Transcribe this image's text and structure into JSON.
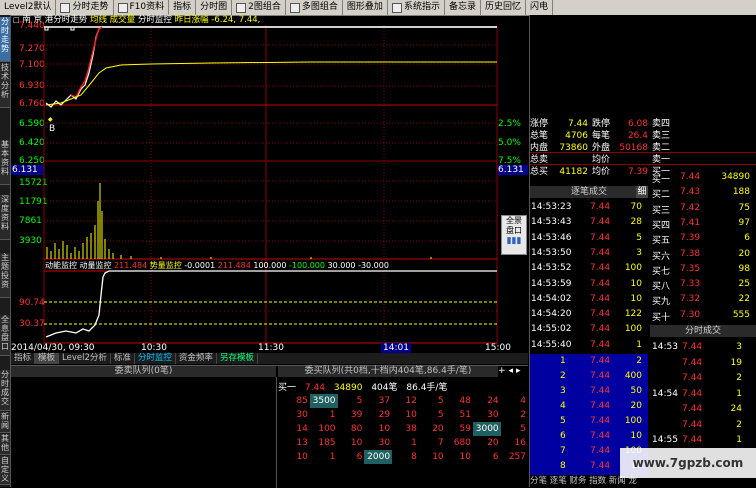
{
  "toolbar": {
    "items": [
      "Level2默认",
      "分时走势",
      "F10资料",
      "指标",
      "分时图",
      "2图组合",
      "多图组合",
      "图形叠加",
      "系统指示",
      "备忘录",
      "历史回忆",
      "闪电"
    ]
  },
  "left_tabs": [
    "分时走势",
    "技术分析",
    "基本资料",
    "深度资料",
    "主题投资",
    "全息盘口",
    "分时成交",
    "新闻",
    "其他",
    "自定义"
  ],
  "chart": {
    "header": {
      "stock": "南  京  港分时走势",
      "avg_line": "均线",
      "volume": "成交量",
      "monitor": "分时监控",
      "prev_rise": "昨日涨幅",
      "prev_rise_val": "-6.24, 7.44,"
    },
    "price_ticks": [
      "7.440",
      "7.270",
      "7.100",
      "6.930",
      "6.760",
      "6.590",
      "6.420",
      "6.250"
    ],
    "pct_ticks": [
      "2.5%",
      "5.0%",
      "7.5%"
    ],
    "current_price": "6.131",
    "current_price_right": "6.131",
    "marker_b": "B",
    "vol_ticks": [
      "15721",
      "11791",
      "7861",
      "3930"
    ],
    "monitor_header": {
      "label1": "动能监控",
      "label2": "动量监控",
      "v1": "211.484",
      "label3": "势量监控",
      "v2": "-0.0001",
      "v3": "211.484",
      "v4": "100.000",
      "v5": "-100.000",
      "v6": "30.000",
      "v7": "-30.000"
    },
    "monitor_ticks": [
      "90.74",
      "30.37"
    ],
    "time_axis": {
      "start": "2014/04/30, 09:30",
      "t1": "10:30",
      "t2": "11:30",
      "t3": "14:01",
      "t4": "15:00"
    },
    "side_button": {
      "l1": "全景",
      "l2": "盘口"
    }
  },
  "bottom_tabs": [
    "指标",
    "模板",
    "Level2分析",
    "标准",
    "分时监控",
    "资金频率",
    "另存模板"
  ],
  "order_queue": {
    "left_title": "委卖队列(0笔)",
    "right_title": "委买队列(共0档,十档内404笔,86.4手/笔)",
    "buy1_label": "买一",
    "buy1_price": "7.44",
    "buy1_vol": "34890",
    "buy1_count": "404笔",
    "buy1_avg": "86.4手/笔",
    "rows": [
      [
        "85",
        "3500",
        "5",
        "37",
        "12",
        "5",
        "48",
        "24",
        "4"
      ],
      [
        "30",
        "1",
        "39",
        "29",
        "10",
        "5",
        "51",
        "30",
        "2"
      ],
      [
        "14",
        "100",
        "80",
        "10",
        "38",
        "20",
        "59",
        "3000",
        "5"
      ],
      [
        "13",
        "185",
        "10",
        "30",
        "1",
        "7",
        "680",
        "20",
        "16"
      ],
      [
        "10",
        "1",
        "6",
        "2000",
        "8",
        "10",
        "10",
        "6",
        "257"
      ]
    ]
  },
  "quotes": {
    "rows": [
      {
        "l": "涨停",
        "v1": "7.44",
        "l2": "跌停",
        "v2": "6.08",
        "l3": "卖四"
      },
      {
        "l": "总笔",
        "v1": "4706",
        "l2": "每笔",
        "v2": "26.4",
        "l3": "卖三"
      },
      {
        "l": "内盘",
        "v1": "73860",
        "l2": "外盘",
        "v2": "50168",
        "l3": "卖二"
      },
      {
        "l": "总卖",
        "v1": "",
        "l2": "均价",
        "v2": "",
        "l3": "卖一"
      },
      {
        "l": "总买",
        "v1": "41182",
        "l2": "均价",
        "v2": "7.39",
        "l3": "买一"
      }
    ],
    "buy_levels": [
      {
        "label": "买一",
        "price": "7.44",
        "vol": "34890"
      },
      {
        "label": "买二",
        "price": "7.43",
        "vol": "188"
      },
      {
        "label": "买三",
        "price": "7.42",
        "vol": "75"
      },
      {
        "label": "买四",
        "price": "7.41",
        "vol": "97"
      },
      {
        "label": "买五",
        "price": "7.39",
        "vol": "6"
      },
      {
        "label": "买六",
        "price": "7.38",
        "vol": "20"
      },
      {
        "label": "买七",
        "price": "7.35",
        "vol": "98"
      },
      {
        "label": "买八",
        "price": "7.33",
        "vol": "25"
      },
      {
        "label": "买九",
        "price": "7.32",
        "vol": "22"
      },
      {
        "label": "买十",
        "price": "7.30",
        "vol": "555"
      }
    ],
    "tick_title": "逐笔成交",
    "tick_tab": "细",
    "ticks": [
      {
        "t": "14:53:23",
        "p": "7.44",
        "v": "70"
      },
      {
        "t": "14:53:43",
        "p": "7.44",
        "v": "28"
      },
      {
        "t": "14:53:46",
        "p": "7.44",
        "v": "5"
      },
      {
        "t": "14:53:50",
        "p": "7.44",
        "v": "3"
      },
      {
        "t": "14:53:52",
        "p": "7.44",
        "v": "100"
      },
      {
        "t": "14:53:59",
        "p": "7.44",
        "v": "10"
      },
      {
        "t": "14:54:02",
        "p": "7.44",
        "v": "10"
      },
      {
        "t": "14:54:20",
        "p": "7.44",
        "v": "122"
      },
      {
        "t": "14:55:02",
        "p": "7.44",
        "v": "100"
      },
      {
        "t": "14:55:40",
        "p": "7.44",
        "v": "1"
      },
      {
        "t": "15:00:21",
        "p": "7.44",
        "v": "10"
      }
    ],
    "queue_rows": [
      {
        "n": "1",
        "p": "7.44",
        "v": "2"
      },
      {
        "n": "2",
        "p": "7.44",
        "v": "400"
      },
      {
        "n": "3",
        "p": "7.44",
        "v": "50"
      },
      {
        "n": "4",
        "p": "7.44",
        "v": "20"
      },
      {
        "n": "5",
        "p": "7.44",
        "v": "100"
      },
      {
        "n": "6",
        "p": "7.44",
        "v": "10"
      },
      {
        "n": "7",
        "p": "7.44",
        "v": "100"
      },
      {
        "n": "8",
        "p": "7.44",
        "v": "10"
      }
    ],
    "fenshi_title": "分时成交",
    "fenshi": [
      {
        "t": "14:53",
        "p": "7.44",
        "v": "3"
      },
      {
        "t": "",
        "p": "7.44",
        "v": "19"
      },
      {
        "t": "",
        "p": "7.44",
        "v": "2"
      },
      {
        "t": "14:54",
        "p": "7.44",
        "v": "1"
      },
      {
        "t": "",
        "p": "7.44",
        "v": "24"
      },
      {
        "t": "",
        "p": "7.44",
        "v": "2"
      },
      {
        "t": "14:55",
        "p": "7.44",
        "v": "1"
      }
    ],
    "bottom_links": "分笔  逐笔  财务  指数  新闻  龙"
  },
  "watermark": "www.7gpzb.com"
}
